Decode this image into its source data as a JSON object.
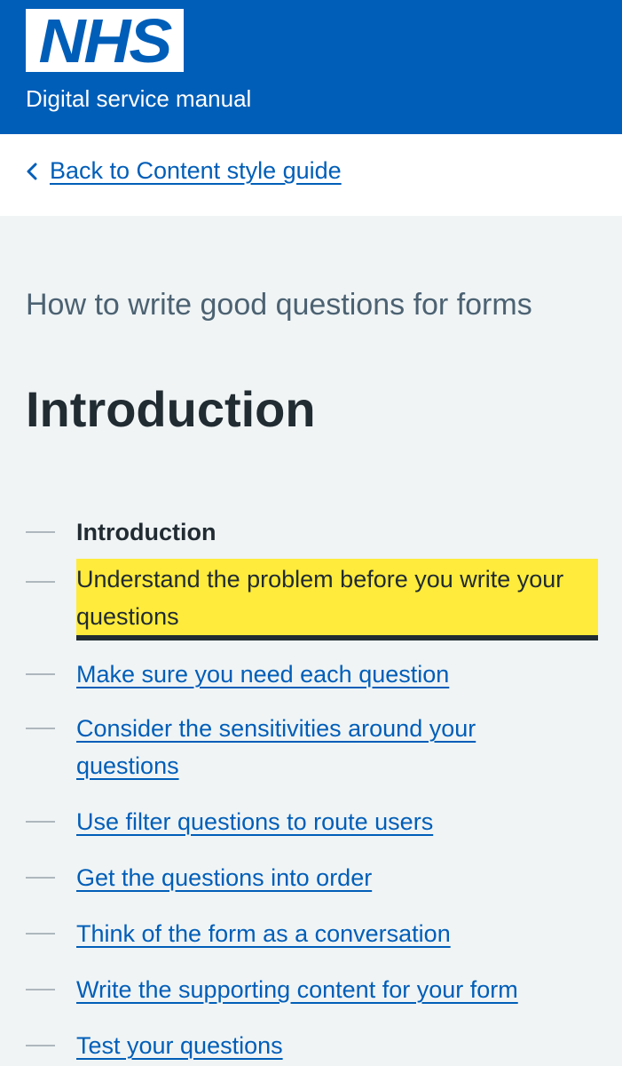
{
  "header": {
    "logo_text": "NHS",
    "service_name": "Digital service manual",
    "colors": {
      "brand": "#005eb8",
      "logo_bg": "#ffffff"
    }
  },
  "back_link": {
    "icon": "chevron-left-icon",
    "label": "Back to Content style guide"
  },
  "page": {
    "caption": "How to write good questions for forms",
    "title": "Introduction"
  },
  "contents": {
    "items": [
      {
        "label": "Introduction",
        "state": "current"
      },
      {
        "label": "Understand the problem before you write your questions",
        "state": "focused"
      },
      {
        "label": "Make sure you need each question",
        "state": "link"
      },
      {
        "label": "Consider the sensitivities around your questions",
        "state": "link"
      },
      {
        "label": "Use filter questions to route users",
        "state": "link"
      },
      {
        "label": "Get the questions into order",
        "state": "link"
      },
      {
        "label": "Think of the form as a conversation",
        "state": "link"
      },
      {
        "label": "Write the supporting content for your form",
        "state": "link"
      },
      {
        "label": "Test your questions",
        "state": "link"
      }
    ]
  },
  "colors": {
    "page_bg": "#f0f4f5",
    "link": "#005eb8",
    "focus_yellow": "#ffeb3b",
    "text": "#212b32",
    "secondary_text": "#4c6272"
  }
}
